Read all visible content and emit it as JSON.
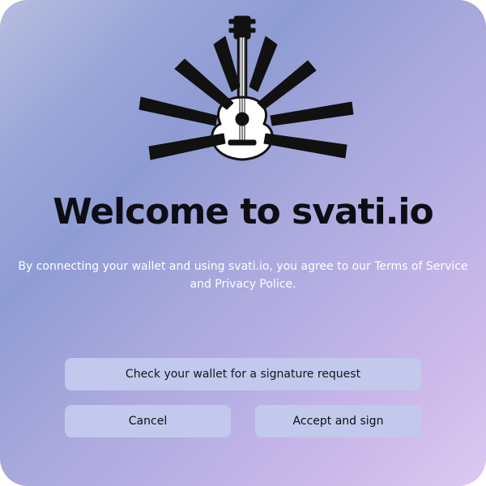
{
  "dialog": {
    "title": "Welcome to svati.io",
    "terms_text": "By connecting your wallet and using svati.io, you agree to our Terms of Service and Privacy Police.",
    "status_message": "Check your wallet for a signature request",
    "cancel_label": "Cancel",
    "accept_label": "Accept and sign",
    "logo_icon": "guitar-with-hands-logo",
    "colors": {
      "gradient_start": "#b6bde0",
      "gradient_mid": "#8f9cd4",
      "gradient_end": "#dcc8f0",
      "button_bg": "#c2c9ec",
      "title_text": "#0d0d14",
      "terms_text": "#ffffff"
    }
  }
}
